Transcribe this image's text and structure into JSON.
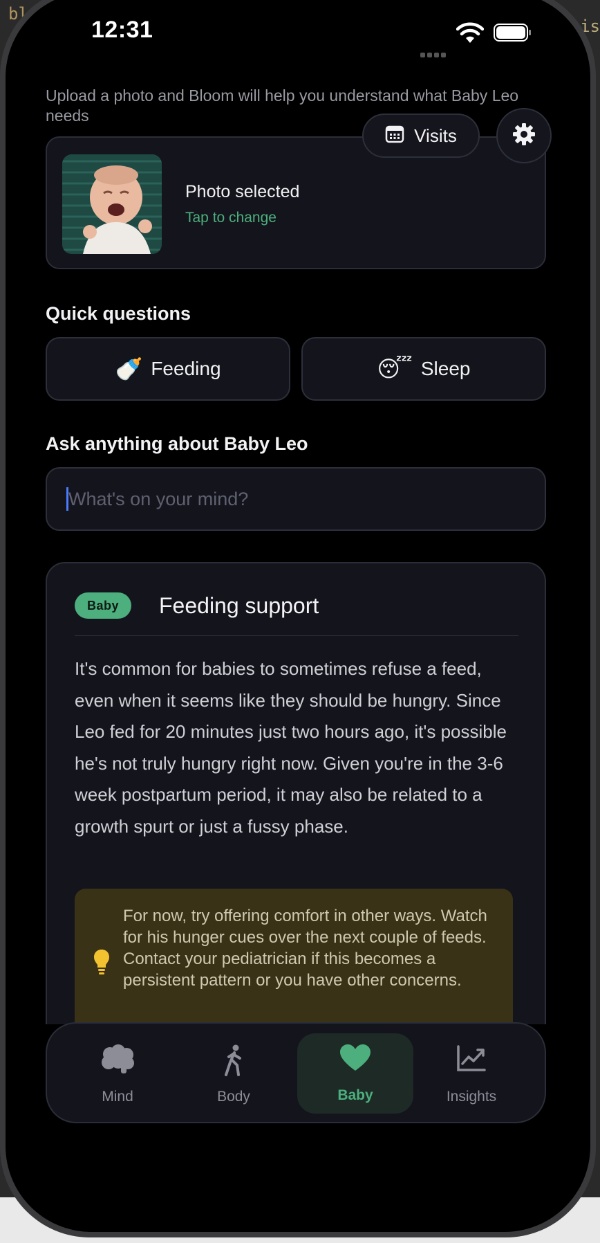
{
  "status_bar": {
    "time": "12:31"
  },
  "intro": {
    "text": "Upload a photo and Bloom will help you understand what Baby Leo needs"
  },
  "header_actions": {
    "visits_label": "Visits"
  },
  "photo": {
    "title": "Photo selected",
    "subtitle": "Tap to change"
  },
  "quick_questions": {
    "heading": "Quick questions",
    "items": [
      {
        "emoji": "🍼",
        "label": "Feeding"
      },
      {
        "emoji": "😴",
        "label": "Sleep"
      }
    ]
  },
  "ask": {
    "heading": "Ask anything about Baby Leo",
    "placeholder": "What's on your mind?",
    "value": ""
  },
  "response": {
    "badge": "Baby",
    "title": "Feeding support",
    "body": "It's common for babies to sometimes refuse a feed, even when it seems like they should be hungry. Since Leo fed for 20 minutes just two hours ago, it's possible he's not truly hungry right now. Given you're in the 3-6 week postpartum period, it may also be related to a growth spurt or just a fussy phase.",
    "tip": "For now, try offering comfort in other ways. Watch for his hunger cues over the next couple of feeds. Contact your pediatrician if this becomes a persistent pattern or you have other concerns."
  },
  "tabs": [
    {
      "label": "Mind",
      "icon": "brain-icon",
      "active": false
    },
    {
      "label": "Body",
      "icon": "walking-person-icon",
      "active": false
    },
    {
      "label": "Baby",
      "icon": "heart-icon",
      "active": true
    },
    {
      "label": "Insights",
      "icon": "trend-chart-icon",
      "active": false
    }
  ],
  "background": {
    "left_snippet": "blo",
    "right_snippet": "sis"
  },
  "colors": {
    "accent": "#4caf7d",
    "card": "#14151c",
    "tip_bg": "#3a3217"
  }
}
